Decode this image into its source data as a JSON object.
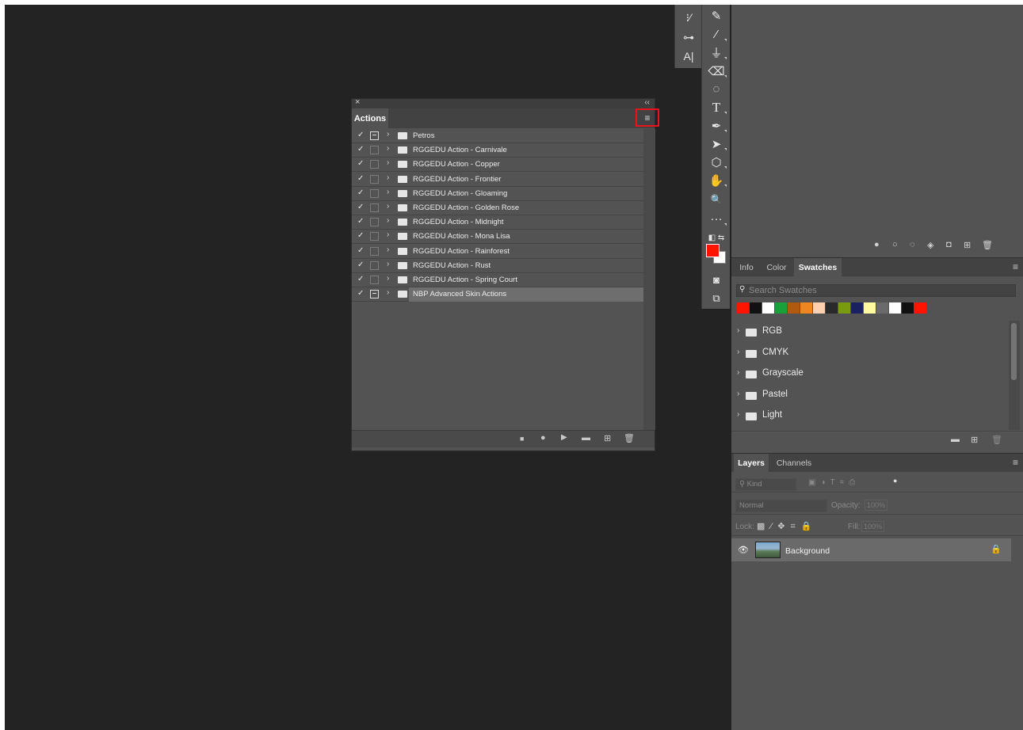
{
  "actions_panel": {
    "close_icon": "×",
    "collapse_icon": "‹‹",
    "tab_label": "Actions",
    "menu_icon": "≡",
    "items": [
      {
        "checked": "✓",
        "dialog": true,
        "name": "Petros"
      },
      {
        "checked": "✓",
        "dialog": false,
        "name": "RGGEDU Action - Carnivale"
      },
      {
        "checked": "✓",
        "dialog": false,
        "name": "RGGEDU Action - Copper"
      },
      {
        "checked": "✓",
        "dialog": false,
        "name": "RGGEDU Action - Frontier"
      },
      {
        "checked": "✓",
        "dialog": false,
        "name": "RGGEDU Action - Gloaming"
      },
      {
        "checked": "✓",
        "dialog": false,
        "name": "RGGEDU Action - Golden Rose"
      },
      {
        "checked": "✓",
        "dialog": false,
        "name": "RGGEDU Action - Midnight"
      },
      {
        "checked": "✓",
        "dialog": false,
        "name": "RGGEDU Action - Mona Lisa"
      },
      {
        "checked": "✓",
        "dialog": false,
        "name": "RGGEDU Action - Rainforest"
      },
      {
        "checked": "✓",
        "dialog": false,
        "name": "RGGEDU Action - Rust"
      },
      {
        "checked": "✓",
        "dialog": false,
        "name": "RGGEDU Action - Spring Court"
      },
      {
        "checked": "✓",
        "dialog": true,
        "name": "NBP Advanced Skin Actions",
        "selected": true
      }
    ],
    "footer": [
      "stop-icon",
      "record-icon",
      "play-icon",
      "new-set-icon",
      "new-action-icon",
      "trash-icon"
    ]
  },
  "mini_tools": [
    {
      "icon": "brush-settings-icon",
      "glyph": "⁝⁄"
    },
    {
      "icon": "adjustments-icon",
      "glyph": "⊶"
    },
    {
      "icon": "character-icon",
      "glyph": "A|"
    }
  ],
  "tools": [
    {
      "icon": "eyedropper-icon",
      "glyph": "✎"
    },
    {
      "icon": "brush-icon",
      "glyph": "⁄"
    },
    {
      "icon": "stamp-icon",
      "glyph": "⏚"
    },
    {
      "icon": "eraser-icon",
      "glyph": "⌫"
    },
    {
      "icon": "gradient-icon",
      "glyph": "◌"
    },
    {
      "icon": "type-icon",
      "glyph": "T"
    },
    {
      "icon": "pen-icon",
      "glyph": "✒"
    },
    {
      "icon": "selection-arrow-icon",
      "glyph": "➤"
    },
    {
      "icon": "shape-icon",
      "glyph": "⬡"
    },
    {
      "icon": "hand-icon",
      "glyph": "✋"
    },
    {
      "icon": "zoom-icon",
      "glyph": "🔍"
    },
    {
      "icon": "more-tools-icon",
      "glyph": "···"
    }
  ],
  "colors": {
    "foreground": "#ff1400",
    "background": "#ffffff",
    "accent_highlight": "#e8141a"
  },
  "mask_bar": [
    "dot-filled-icon",
    "dot-empty-icon",
    "selection-dotted-icon",
    "diamond-icon",
    "mask-icon",
    "add-icon",
    "trash-icon"
  ],
  "swatches_panel": {
    "tabs": [
      "Info",
      "Color",
      "Swatches"
    ],
    "active_tab": "Swatches",
    "search_placeholder": "Search Swatches",
    "recent": [
      "#ff1400",
      "#111111",
      "#ffffff",
      "#1aa03a",
      "#b05a10",
      "#f08620",
      "#ffd0b0",
      "#2a2a2a",
      "#7a9a10",
      "#1a2060",
      "#fffaa0",
      "#6a6a6a",
      "#ffffff",
      "#111111",
      "#ff1400"
    ],
    "groups": [
      "RGB",
      "CMYK",
      "Grayscale",
      "Pastel",
      "Light"
    ]
  },
  "layers_panel": {
    "tabs": [
      "Layers",
      "Channels"
    ],
    "active_tab": "Layers",
    "kind_label": "Kind",
    "blend_mode": "Normal",
    "opacity_label": "Opacity:",
    "opacity_value": "100%",
    "lock_label": "Lock:",
    "fill_label": "Fill:",
    "fill_value": "100%",
    "layers": [
      {
        "name": "Background",
        "visible": true,
        "locked": true
      }
    ]
  }
}
